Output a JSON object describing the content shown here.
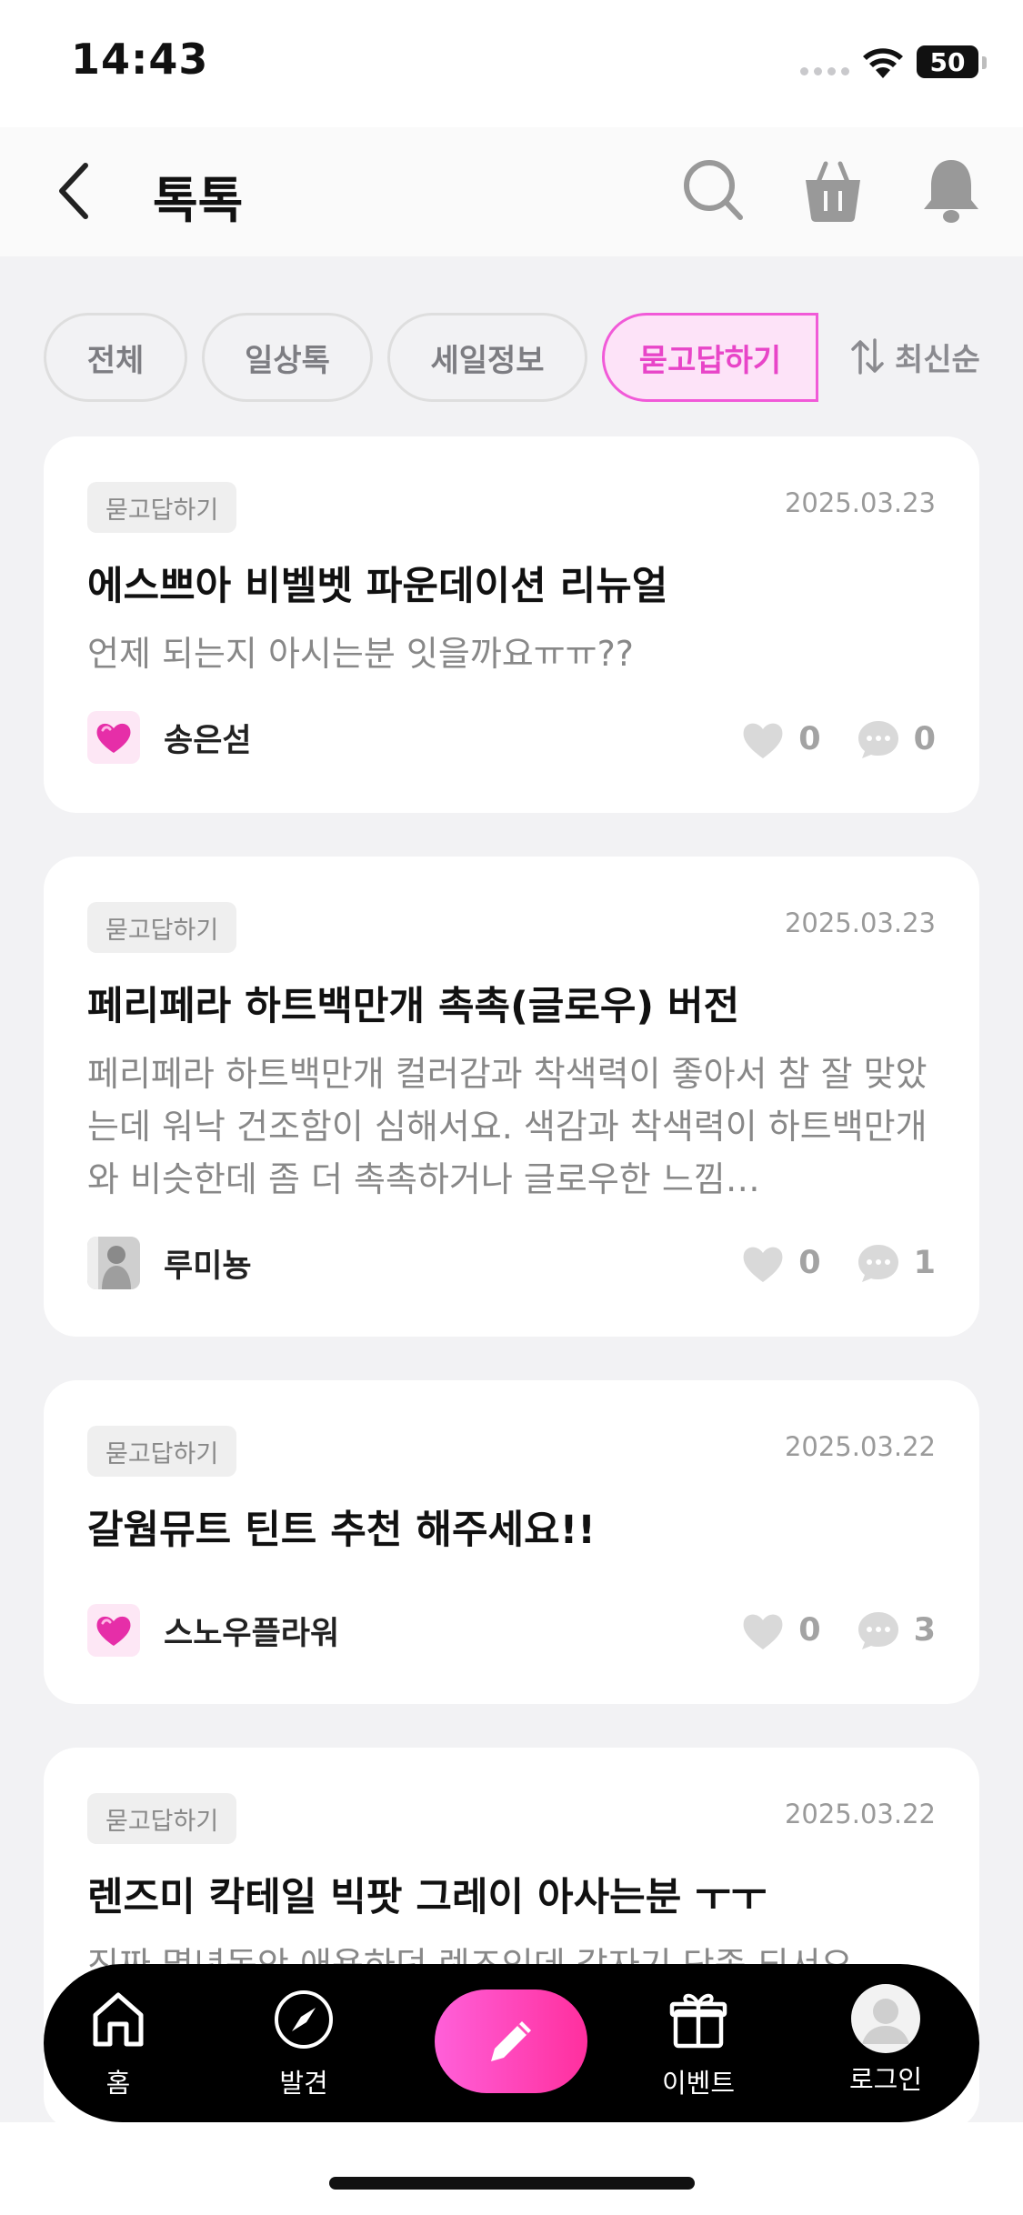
{
  "status_bar": {
    "time": "14:43",
    "battery": "50"
  },
  "header": {
    "title": "톡톡"
  },
  "filters": {
    "chips": [
      "전체",
      "일상톡",
      "세일정보",
      "묻고답하기"
    ],
    "active_index": 3,
    "sort_label": "최신순"
  },
  "posts": [
    {
      "category": "묻고답하기",
      "date": "2025.03.23",
      "title": "에스쁘아 비벨벳 파운데이션 리뉴얼",
      "body": "언제 되는지 아시는분 잇을까요ㅠㅠ??",
      "author": "송은섣",
      "likes": "0",
      "comments": "0"
    },
    {
      "category": "묻고답하기",
      "date": "2025.03.23",
      "title": "페리페라 하트백만개 촉촉(글로우) 버전",
      "body": "페리페라 하트백만개 컬러감과 착색력이 좋아서 참 잘 맞았는데 워낙 건조함이 심해서요. 색감과 착색력이 하트백만개와 비슷한데 좀 더 촉촉하거나 글로우한 느낌…",
      "author": "루미뇽",
      "likes": "0",
      "comments": "1"
    },
    {
      "category": "묻고답하기",
      "date": "2025.03.22",
      "title": "갈웜뮤트 틴트 추천 해주세요!!",
      "body": "",
      "author": "스노우플라워",
      "likes": "0",
      "comments": "3"
    },
    {
      "category": "묻고답하기",
      "date": "2025.03.22",
      "title": "렌즈미 칵테일 빅팟 그레이 아사는분 ㅜㅜ",
      "body": "진짜 몇년동안 애용하던 렌즈인데 갑자기 단종 되서요",
      "author": "",
      "likes": "",
      "comments": ""
    }
  ],
  "bottom_nav": {
    "home": "홈",
    "discover": "발견",
    "event": "이벤트",
    "login": "로그인"
  },
  "colors": {
    "accent": "#f15ad8",
    "accent_bg": "#fde3f8",
    "nav_bg": "#000000",
    "write_gradient": "#ff60d9"
  }
}
